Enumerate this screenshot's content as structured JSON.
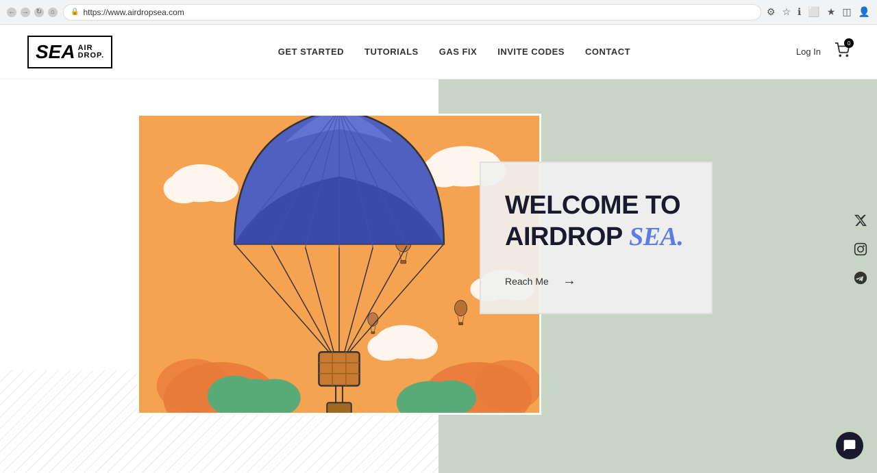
{
  "browser": {
    "url": "https://www.airdropsea.com",
    "back_icon": "←",
    "forward_icon": "→",
    "refresh_icon": "↻",
    "home_icon": "⌂"
  },
  "navbar": {
    "logo_sea": "SEA",
    "logo_air": "AIR",
    "logo_drop": "DROP.",
    "nav_items": [
      {
        "label": "GET STARTED",
        "id": "get-started"
      },
      {
        "label": "TUTORIALS",
        "id": "tutorials"
      },
      {
        "label": "GAS FIX",
        "id": "gas-fix"
      },
      {
        "label": "INVITE CODES",
        "id": "invite-codes"
      },
      {
        "label": "CONTACT",
        "id": "contact"
      }
    ],
    "login_label": "Log In",
    "cart_count": "0"
  },
  "hero": {
    "welcome_line1": "WELCOME TO",
    "welcome_line2": "AIRDROP",
    "welcome_sea": "SEA.",
    "reach_me_label": "Reach Me",
    "arrow": "→"
  },
  "social": {
    "x_icon": "𝕏",
    "instagram_icon": "◎",
    "telegram_icon": "✈"
  },
  "chat": {
    "icon": "💬"
  }
}
